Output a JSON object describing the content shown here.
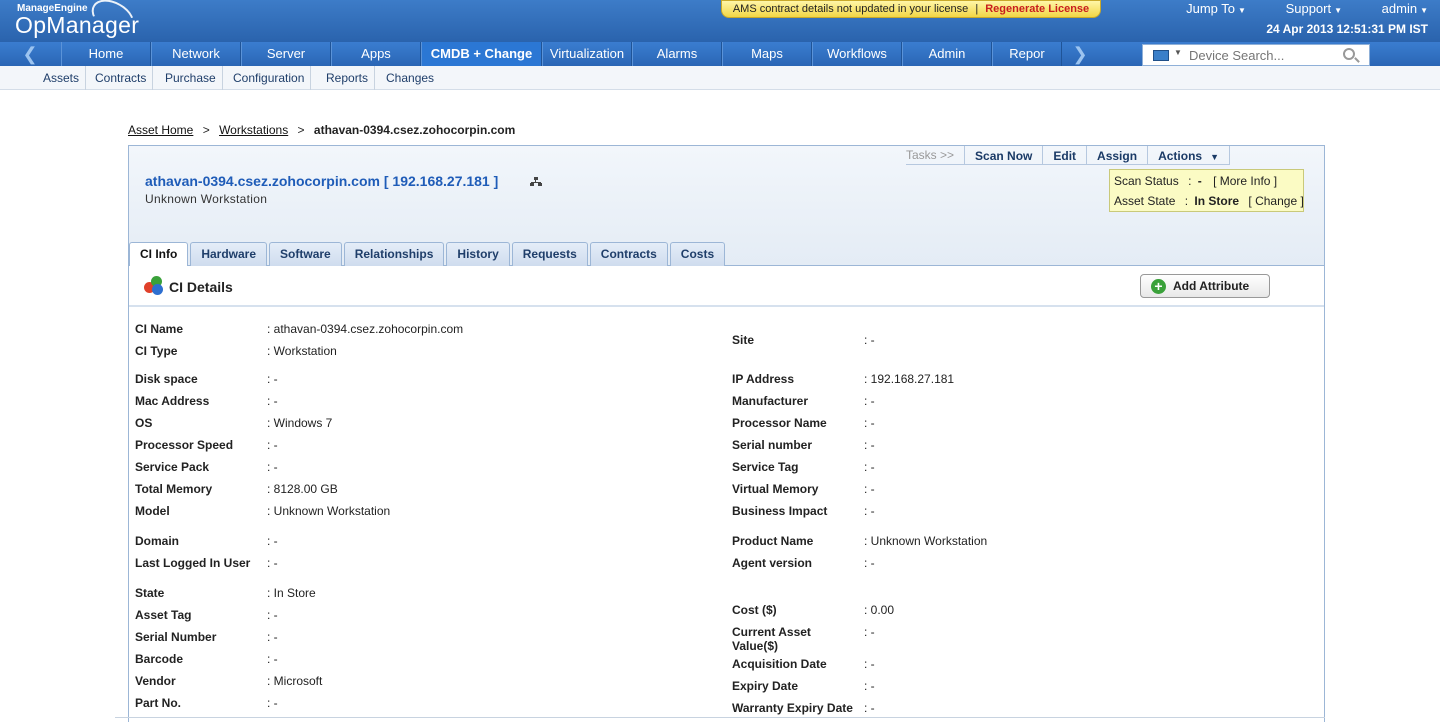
{
  "brand": {
    "small": "ManageEngine",
    "big": "OpManager"
  },
  "license_banner": {
    "text": "AMS contract details not updated in your license",
    "sep": "|",
    "action": "Regenerate License"
  },
  "top_links": [
    "Jump To",
    "Support",
    "admin"
  ],
  "datetime": "24 Apr 2013 12:51:31 PM IST",
  "nav": {
    "tabs": [
      "Home",
      "Network",
      "Server",
      "Apps",
      "CMDB + Change",
      "Virtualization",
      "Alarms",
      "Maps",
      "Workflows",
      "Admin",
      "Repor"
    ],
    "active": "CMDB + Change"
  },
  "device_search": {
    "placeholder": "Device Search..."
  },
  "subnav": [
    "Assets",
    "Contracts",
    "Purchase",
    "Configuration",
    "Reports",
    "Changes"
  ],
  "breadcrumb": {
    "home": "Asset Home",
    "sep": ">",
    "workstations": "Workstations",
    "current": "athavan-0394.csez.zohocorpin.com"
  },
  "toolbar": {
    "tasks": "Tasks >>",
    "scan": "Scan Now",
    "edit": "Edit",
    "assign": "Assign",
    "actions": "Actions"
  },
  "host": {
    "title": "athavan-0394.csez.zohocorpin.com [ 192.168.27.181 ]",
    "subtitle": "Unknown Workstation"
  },
  "status_box": {
    "scan_label": "Scan Status",
    "scan_value": "-",
    "more_info": "[ More Info ]",
    "state_label": "Asset State",
    "state_value": "In Store",
    "change": "[ Change ]",
    "colon": ":"
  },
  "tabs": [
    "CI Info",
    "Hardware",
    "Software",
    "Relationships",
    "History",
    "Requests",
    "Contracts",
    "Costs"
  ],
  "section": {
    "title": "CI Details",
    "add_button": "Add Attribute"
  },
  "left_fields": [
    {
      "label": "CI Name",
      "value": "athavan-0394.csez.zohocorpin.com"
    },
    {
      "label": "CI Type",
      "value": "Workstation"
    },
    {
      "label": "Disk space",
      "value": "-"
    },
    {
      "label": "Mac Address",
      "value": "-"
    },
    {
      "label": "OS",
      "value": "Windows 7"
    },
    {
      "label": "Processor Speed",
      "value": "-"
    },
    {
      "label": "Service Pack",
      "value": "-"
    },
    {
      "label": "Total Memory",
      "value": "8128.00 GB"
    },
    {
      "label": "Model",
      "value": "Unknown Workstation"
    },
    {
      "label": "Domain",
      "value": "-"
    },
    {
      "label": "Last Logged In User",
      "value": "-"
    },
    {
      "label": "State",
      "value": "In Store"
    },
    {
      "label": "Asset Tag",
      "value": "-"
    },
    {
      "label": "Serial Number",
      "value": "-"
    },
    {
      "label": "Barcode",
      "value": "-"
    },
    {
      "label": "Vendor",
      "value": "Microsoft"
    },
    {
      "label": "Part No.",
      "value": "-"
    }
  ],
  "right_fields": [
    {
      "label": "Site",
      "value": "-"
    },
    {
      "label": "IP Address",
      "value": "192.168.27.181"
    },
    {
      "label": "Manufacturer",
      "value": "-"
    },
    {
      "label": "Processor Name",
      "value": "-"
    },
    {
      "label": "Serial number",
      "value": "-"
    },
    {
      "label": "Service Tag",
      "value": "-"
    },
    {
      "label": "Virtual Memory",
      "value": "-"
    },
    {
      "label": "Business Impact",
      "value": "-"
    },
    {
      "label": "Product Name",
      "value": "Unknown Workstation"
    },
    {
      "label": "Agent version",
      "value": "-"
    },
    {
      "label": "Cost ($)",
      "value": "0.00"
    },
    {
      "label": "Current Asset Value($)",
      "value": "-"
    },
    {
      "label": "Acquisition Date",
      "value": "-"
    },
    {
      "label": "Expiry Date",
      "value": "-"
    },
    {
      "label": "Warranty Expiry Date",
      "value": "-"
    }
  ]
}
